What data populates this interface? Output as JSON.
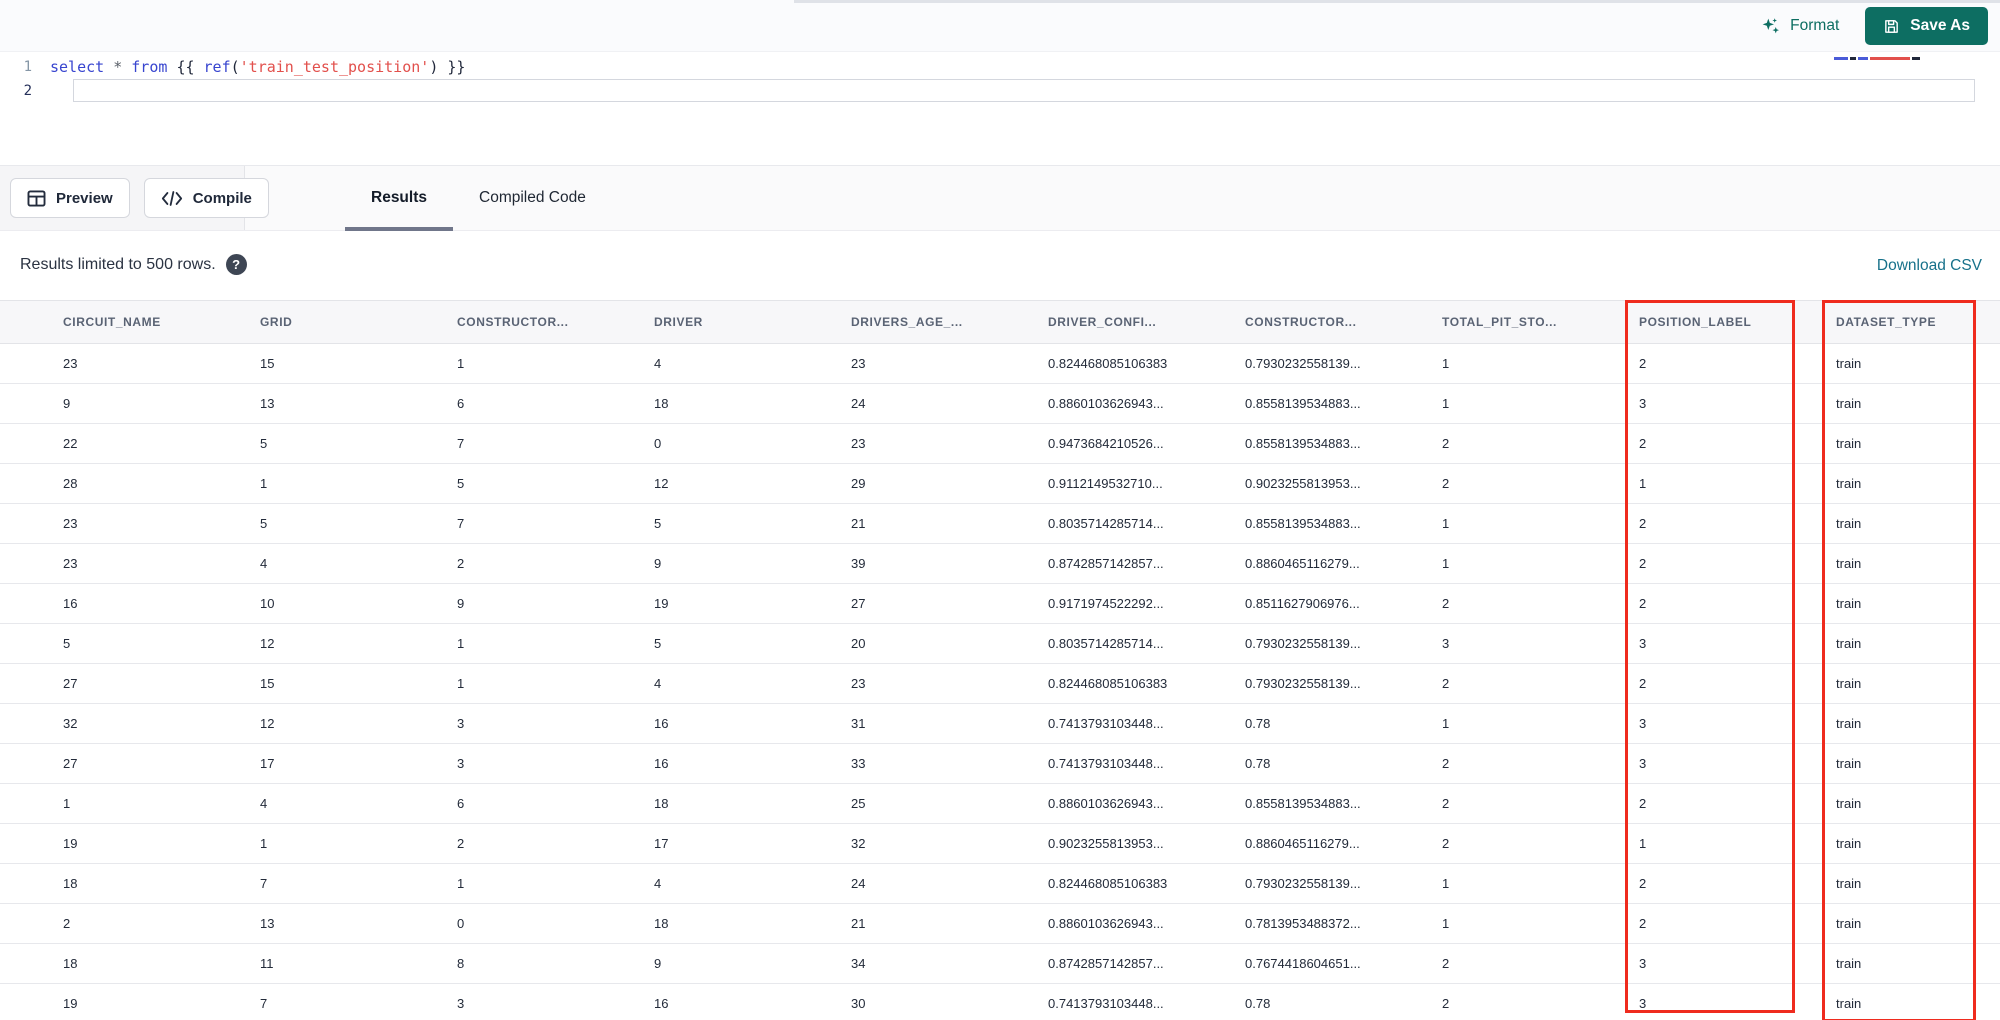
{
  "toolbar": {
    "format_label": "Format",
    "save_as_label": "Save As"
  },
  "editor": {
    "line_numbers": [
      "1",
      "2"
    ],
    "code_tokens": [
      {
        "text": "select",
        "cls": "kw"
      },
      {
        "text": " ",
        "cls": "punct"
      },
      {
        "text": "*",
        "cls": "op"
      },
      {
        "text": " ",
        "cls": "punct"
      },
      {
        "text": "from",
        "cls": "kw"
      },
      {
        "text": " ",
        "cls": "punct"
      },
      {
        "text": "{{",
        "cls": "punct"
      },
      {
        "text": " ",
        "cls": "punct"
      },
      {
        "text": "ref",
        "cls": "fn"
      },
      {
        "text": "(",
        "cls": "punct"
      },
      {
        "text": "'train_test_position'",
        "cls": "str"
      },
      {
        "text": ")",
        "cls": "punct"
      },
      {
        "text": " ",
        "cls": "punct"
      },
      {
        "text": "}}",
        "cls": "punct"
      }
    ],
    "minimap_segments": [
      {
        "color": "#4a5bd8",
        "width": 14
      },
      {
        "color": "#21283b",
        "width": 6
      },
      {
        "color": "#4a5bd8",
        "width": 10
      },
      {
        "color": "#e2504c",
        "width": 40
      },
      {
        "color": "#21283b",
        "width": 8
      }
    ]
  },
  "actions": {
    "preview_label": "Preview",
    "compile_label": "Compile"
  },
  "tabs": [
    {
      "label": "Results",
      "active": true
    },
    {
      "label": "Compiled Code",
      "active": false
    }
  ],
  "results_bar": {
    "info_text": "Results limited to 500 rows.",
    "download_label": "Download CSV"
  },
  "table": {
    "columns": [
      "CIRCUIT_NAME",
      "GRID",
      "CONSTRUCTOR...",
      "DRIVER",
      "DRIVERS_AGE_...",
      "DRIVER_CONFI...",
      "CONSTRUCTOR...",
      "TOTAL_PIT_STO...",
      "POSITION_LABEL",
      "DATASET_TYPE"
    ],
    "highlighted_columns": [
      "POSITION_LABEL",
      "DATASET_TYPE"
    ],
    "rows": [
      [
        "23",
        "15",
        "1",
        "4",
        "23",
        "0.824468085106383",
        "0.7930232558139...",
        "1",
        "2",
        "train"
      ],
      [
        "9",
        "13",
        "6",
        "18",
        "24",
        "0.8860103626943...",
        "0.8558139534883...",
        "1",
        "3",
        "train"
      ],
      [
        "22",
        "5",
        "7",
        "0",
        "23",
        "0.9473684210526...",
        "0.8558139534883...",
        "2",
        "2",
        "train"
      ],
      [
        "28",
        "1",
        "5",
        "12",
        "29",
        "0.9112149532710...",
        "0.9023255813953...",
        "2",
        "1",
        "train"
      ],
      [
        "23",
        "5",
        "7",
        "5",
        "21",
        "0.8035714285714...",
        "0.8558139534883...",
        "1",
        "2",
        "train"
      ],
      [
        "23",
        "4",
        "2",
        "9",
        "39",
        "0.8742857142857...",
        "0.8860465116279...",
        "1",
        "2",
        "train"
      ],
      [
        "16",
        "10",
        "9",
        "19",
        "27",
        "0.9171974522292...",
        "0.8511627906976...",
        "2",
        "2",
        "train"
      ],
      [
        "5",
        "12",
        "1",
        "5",
        "20",
        "0.8035714285714...",
        "0.7930232558139...",
        "3",
        "3",
        "train"
      ],
      [
        "27",
        "15",
        "1",
        "4",
        "23",
        "0.824468085106383",
        "0.7930232558139...",
        "2",
        "2",
        "train"
      ],
      [
        "32",
        "12",
        "3",
        "16",
        "31",
        "0.7413793103448...",
        "0.78",
        "1",
        "3",
        "train"
      ],
      [
        "27",
        "17",
        "3",
        "16",
        "33",
        "0.7413793103448...",
        "0.78",
        "2",
        "3",
        "train"
      ],
      [
        "1",
        "4",
        "6",
        "18",
        "25",
        "0.8860103626943...",
        "0.8558139534883...",
        "2",
        "2",
        "train"
      ],
      [
        "19",
        "1",
        "2",
        "17",
        "32",
        "0.9023255813953...",
        "0.8860465116279...",
        "2",
        "1",
        "train"
      ],
      [
        "18",
        "7",
        "1",
        "4",
        "24",
        "0.824468085106383",
        "0.7930232558139...",
        "1",
        "2",
        "train"
      ],
      [
        "2",
        "13",
        "0",
        "18",
        "21",
        "0.8860103626943...",
        "0.7813953488372...",
        "1",
        "2",
        "train"
      ],
      [
        "18",
        "11",
        "8",
        "9",
        "34",
        "0.8742857142857...",
        "0.7674418604651...",
        "2",
        "3",
        "train"
      ],
      [
        "19",
        "7",
        "3",
        "16",
        "30",
        "0.7413793103448...",
        "0.78",
        "2",
        "3",
        "train"
      ]
    ]
  },
  "colors": {
    "accent_teal": "#0d6e62",
    "link_teal": "#17718a",
    "highlight_red": "#ef2b1e"
  }
}
